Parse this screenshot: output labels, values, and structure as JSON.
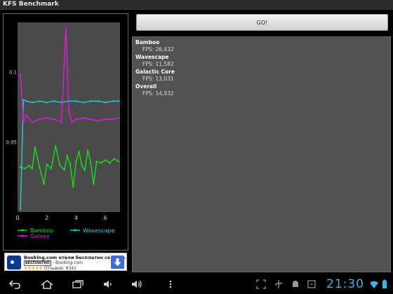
{
  "app": {
    "title": "KFS Benchmark"
  },
  "toolbar": {
    "go_label": "GO!"
  },
  "results": [
    {
      "name": "Bamboo",
      "fps": "FPS: 26,432"
    },
    {
      "name": "Wavescape",
      "fps": "FPS: 11,582"
    },
    {
      "name": "Galactic Core",
      "fps": "FPS: 13,031"
    },
    {
      "name": "Overall",
      "fps": "FPS: 14,932"
    }
  ],
  "chart_data": {
    "type": "line",
    "x_ticks": [
      "0",
      "2",
      "4",
      "6"
    ],
    "y_ticks": [
      "0.05",
      "0.1"
    ],
    "xlim": [
      0,
      7
    ],
    "ylim": [
      0,
      0.135
    ],
    "legend": [
      "Bamboo",
      "Wavescape",
      "Galaxy"
    ],
    "series": [
      {
        "name": "Bamboo",
        "color": "#16e016",
        "x": [
          0.2,
          0.5,
          0.8,
          1.0,
          1.2,
          1.5,
          1.8,
          2.0,
          2.3,
          2.6,
          2.9,
          3.2,
          3.4,
          3.6,
          3.8,
          4.0,
          4.2,
          4.4,
          4.6,
          4.8,
          5.0,
          5.2,
          5.4,
          5.7,
          6.0,
          6.3,
          6.6,
          6.9
        ],
        "values": [
          0.032,
          0.031,
          0.033,
          0.031,
          0.046,
          0.032,
          0.02,
          0.034,
          0.031,
          0.047,
          0.033,
          0.03,
          0.04,
          0.034,
          0.018,
          0.036,
          0.043,
          0.033,
          0.03,
          0.044,
          0.035,
          0.02,
          0.036,
          0.035,
          0.037,
          0.035,
          0.038,
          0.036
        ]
      },
      {
        "name": "Wavescape",
        "color": "#1ad6d6",
        "x": [
          0.2,
          0.4,
          0.6,
          1.0,
          1.5,
          2.0,
          2.5,
          3.0,
          3.5,
          4.0,
          4.5,
          5.0,
          5.5,
          6.0,
          6.5,
          6.9
        ],
        "values": [
          0.002,
          0.08,
          0.079,
          0.078,
          0.079,
          0.078,
          0.079,
          0.078,
          0.079,
          0.079,
          0.078,
          0.079,
          0.079,
          0.078,
          0.079,
          0.079
        ]
      },
      {
        "name": "Galaxy",
        "color": "#e01ae0",
        "x": [
          0.2,
          0.4,
          0.6,
          1.0,
          1.5,
          2.0,
          2.5,
          3.0,
          3.3,
          3.5,
          3.7,
          4.0,
          4.5,
          5.0,
          5.5,
          6.0,
          6.5,
          6.9
        ],
        "values": [
          0.098,
          0.064,
          0.069,
          0.064,
          0.066,
          0.067,
          0.066,
          0.064,
          0.131,
          0.072,
          0.064,
          0.066,
          0.067,
          0.066,
          0.065,
          0.066,
          0.066,
          0.067
        ]
      }
    ]
  },
  "ad": {
    "title": "Booking.com отели бесплатно скачать",
    "badge": "БЕСПЛАТНО",
    "source": "- Booking.com",
    "stars": "★★★★★",
    "reviews": "Отзывов: 9342"
  },
  "status": {
    "time": "21:30"
  }
}
